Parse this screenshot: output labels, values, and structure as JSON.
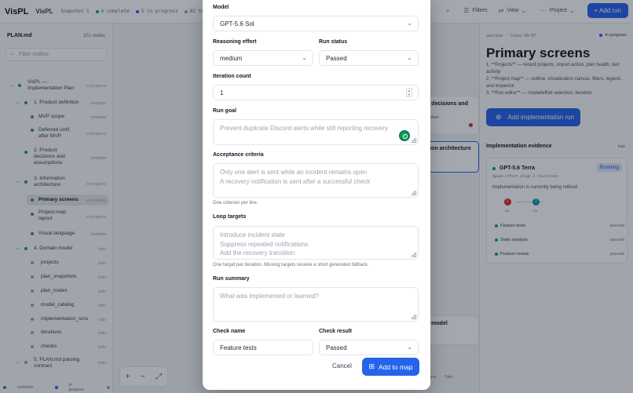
{
  "topbar": {
    "brand": "VisPL",
    "project": "VisPL",
    "snapshot": "Snapshot 1",
    "stats": [
      {
        "label": "4 complete",
        "color": "#16a34a"
      },
      {
        "label": "5 in progress",
        "color": "#2563eb"
      },
      {
        "label": "82 todo",
        "color": "#9ca3af"
      }
    ],
    "filters_label": "Filters",
    "view_label": "View",
    "project_label": "Project",
    "add_run_label": "Add run"
  },
  "outline": {
    "file": "PLAN.md",
    "count": "101 nodes",
    "filter_placeholder": "Filter outline",
    "items": [
      {
        "label": "VisPL — Implementation Plan",
        "tag": "in progress"
      },
      {
        "label": "1. Product definition",
        "tag": "complete"
      },
      {
        "label": "MVP scope",
        "tag": "complete"
      },
      {
        "label": "Deferred until after MVP",
        "tag": "in progress"
      },
      {
        "label": "2. Product decisions and assumptions",
        "tag": "complete"
      },
      {
        "label": "3. Information architecture",
        "tag": "in progress"
      },
      {
        "label": "Primary screens",
        "tag": "in progress"
      },
      {
        "label": "Project-map layout",
        "tag": "in progress"
      },
      {
        "label": "Visual language",
        "tag": "complete"
      },
      {
        "label": "4. Domain model",
        "tag": "todo"
      },
      {
        "label": "projects",
        "tag": "todo"
      },
      {
        "label": "plan_snapshots",
        "tag": "todo"
      },
      {
        "label": "plan_nodes",
        "tag": "todo"
      },
      {
        "label": "model_catalog",
        "tag": "todo"
      },
      {
        "label": "implementation_runs",
        "tag": "todo"
      },
      {
        "label": "iterations",
        "tag": "todo"
      },
      {
        "label": "checks",
        "tag": "todo"
      },
      {
        "label": "5. PLAN.md parsing contract",
        "tag": "todo"
      }
    ],
    "legend": [
      "complete",
      "in progress",
      "todo"
    ]
  },
  "canvas": {
    "zoom_in": "+",
    "zoom_out": "−",
    "fit": "⤢",
    "node_labels": [
      "ct decisions and",
      "ation architecture",
      "in model"
    ],
    "node_meta": [
      "medium",
      "gh"
    ],
    "status_footer": [
      "progress",
      "Todo"
    ]
  },
  "inspector": {
    "section": "section · lines 50–57",
    "status": "In progress",
    "title": "Primary screens",
    "body_lines": [
      "1. **Projects** — recent projects, import action, plan health, last activity",
      "2. **Project map** — outline, visualization canvas, filters, legend, and inspector",
      "3. **Run editor** — model/effort selection, iteration"
    ],
    "add_run_label": "Add implementation run",
    "evidence_heading": "Implementation evidence",
    "logs_label": "logs",
    "run": {
      "model": "GPT-5.6 Terra",
      "status": "Running",
      "meta": "Speed effort xhigh 2 iterations",
      "desc": "Implementation is currently being refined",
      "iterations": [
        {
          "n": "1",
          "label": "Rn",
          "color": "#dc2626"
        },
        {
          "n": "2",
          "label": "Rn",
          "color": "#0891b2"
        }
      ],
      "checks": [
        {
          "name": "Feature tests",
          "status": "passed"
        },
        {
          "name": "Static analysis",
          "status": "passed"
        },
        {
          "name": "Product review",
          "status": "passed"
        }
      ]
    }
  },
  "modal": {
    "model_label": "Model",
    "model_value": "GPT-5.6 Sol",
    "effort_label": "Reasoning effort",
    "effort_value": "medium",
    "status_label": "Run status",
    "status_value": "Passed",
    "iteration_label": "Iteration count",
    "iteration_value": "1",
    "goal_label": "Run goal",
    "goal_placeholder": "Prevent duplicate Discord alerts while still reporting recovery",
    "criteria_label": "Acceptance criteria",
    "criteria_lines": [
      "Only one alert is sent while an incident remains open",
      "A recovery notification is sent after a successful check"
    ],
    "criteria_help": "One criterion per line.",
    "targets_label": "Loop targets",
    "targets_lines": [
      "Introduce incident state",
      "Suppress repeated notifications",
      "Add the recovery transition"
    ],
    "targets_help": "One target per iteration. Missing targets receive a short generated fallback.",
    "summary_label": "Run summary",
    "summary_placeholder": "What was implemented or learned?",
    "check_name_label": "Check name",
    "check_name_value": "Feature tests",
    "check_result_label": "Check result",
    "check_result_value": "Passed",
    "cancel_label": "Cancel",
    "submit_label": "Add to map"
  }
}
